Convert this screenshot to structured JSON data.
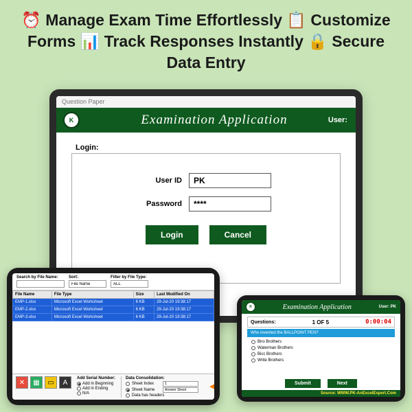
{
  "headline": "⏰ Manage Exam Time Effortlessly 📋 Customize Forms 📊 Track Responses Instantly 🔒 Secure Data Entry",
  "main": {
    "window_title": "Question Paper",
    "app_title": "Examination Application",
    "user_label": "User:",
    "logo_text": "K",
    "login": {
      "legend": "Login:",
      "userid_label": "User ID",
      "userid_value": "PK",
      "password_label": "Password",
      "password_value": "****",
      "login_btn": "Login",
      "cancel_btn": "Cancel"
    }
  },
  "files": {
    "search_label": "Search by File Name:",
    "search_value": "",
    "sort_label": "Sort:",
    "sort_value": "File Name",
    "filter_label": "Filter by File Type:",
    "filter_value": "ALL",
    "cols": {
      "c1": "File Name",
      "c2": "File Type",
      "c3": "Size",
      "c4": "Last Modified On"
    },
    "rows": [
      {
        "name": "EMP-1.xlsx",
        "type": "Microsoft Excel Worksheet",
        "size": "6 KB",
        "mod": "29-Jul-20 19:38:17"
      },
      {
        "name": "EMP-2.xlsx",
        "type": "Microsoft Excel Worksheet",
        "size": "6 KB",
        "mod": "29-Jul-20 19:38:17"
      },
      {
        "name": "EMP-3.xlsx",
        "type": "Microsoft Excel Worksheet",
        "size": "6 KB",
        "mod": "29-Jul-20 19:38:17"
      }
    ],
    "serial": {
      "hdr": "Add Serial Number:",
      "o1": "Add in Beginning",
      "o2": "Add in Ending",
      "o3": "N/A"
    },
    "cons": {
      "hdr": "Data Consolidation:",
      "k1": "Sheet Index",
      "v1": "1",
      "k2": "Sheet Name",
      "v2": "Answer Sheet",
      "k3": "Data has headers"
    }
  },
  "quiz": {
    "app_title": "Examination Application",
    "user_label": "User:",
    "user_value": "PK",
    "questions_label": "Questions:",
    "counter": "1 OF 5",
    "timer": "0:00:04",
    "question_text": "Who invented the BALLPOINT PEN?",
    "opts": {
      "a": "Biro Brothers",
      "b": "Waterman Brothers",
      "c": "Bicc Brothers",
      "d": "Write Brothers"
    },
    "submit_btn": "Submit",
    "next_btn": "Next",
    "source": "Source: WWW.PK-AnExcelExpert.Com"
  }
}
